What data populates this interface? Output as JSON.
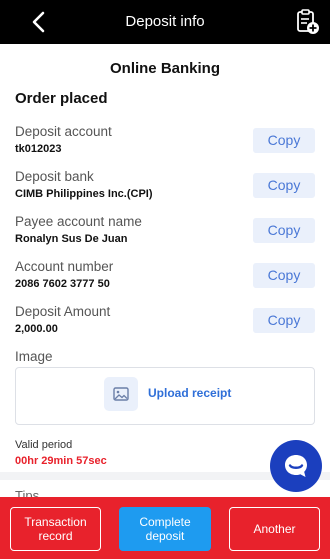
{
  "header": {
    "title": "Deposit info"
  },
  "subtitle": "Online Banking",
  "order_status": "Order placed",
  "fields": [
    {
      "label": "Deposit account",
      "value": "tk012023",
      "copy_label": "Copy"
    },
    {
      "label": "Deposit bank",
      "value": "CIMB Philippines Inc.(CPI)",
      "copy_label": "Copy"
    },
    {
      "label": "Payee account name",
      "value": "Ronalyn Sus De Juan",
      "copy_label": "Copy"
    },
    {
      "label": "Account number",
      "value": "2086 7602 3777 50",
      "copy_label": "Copy"
    },
    {
      "label": "Deposit Amount",
      "value": "2,000.00",
      "copy_label": "Copy"
    }
  ],
  "image_section": {
    "label": "Image",
    "upload_label": "Upload receipt"
  },
  "valid_period": {
    "label": "Valid period",
    "time": "00hr 29min 57sec"
  },
  "tips_label": "Tips",
  "footer": {
    "transaction_record": "Transaction record",
    "complete_deposit": "Complete deposit",
    "another": "Another"
  },
  "colors": {
    "header_bg": "#000000",
    "footer_bg": "#e8222c",
    "primary_blue": "#1e9bf0",
    "countdown_red": "#e8212b",
    "copy_bg": "#eaf0fb",
    "chat_fab": "#1b3fbe"
  },
  "icons": {
    "back": "chevron-left-icon",
    "records": "clipboard-record-icon",
    "upload": "image-upload-icon",
    "chat": "chat-bubble-icon"
  }
}
